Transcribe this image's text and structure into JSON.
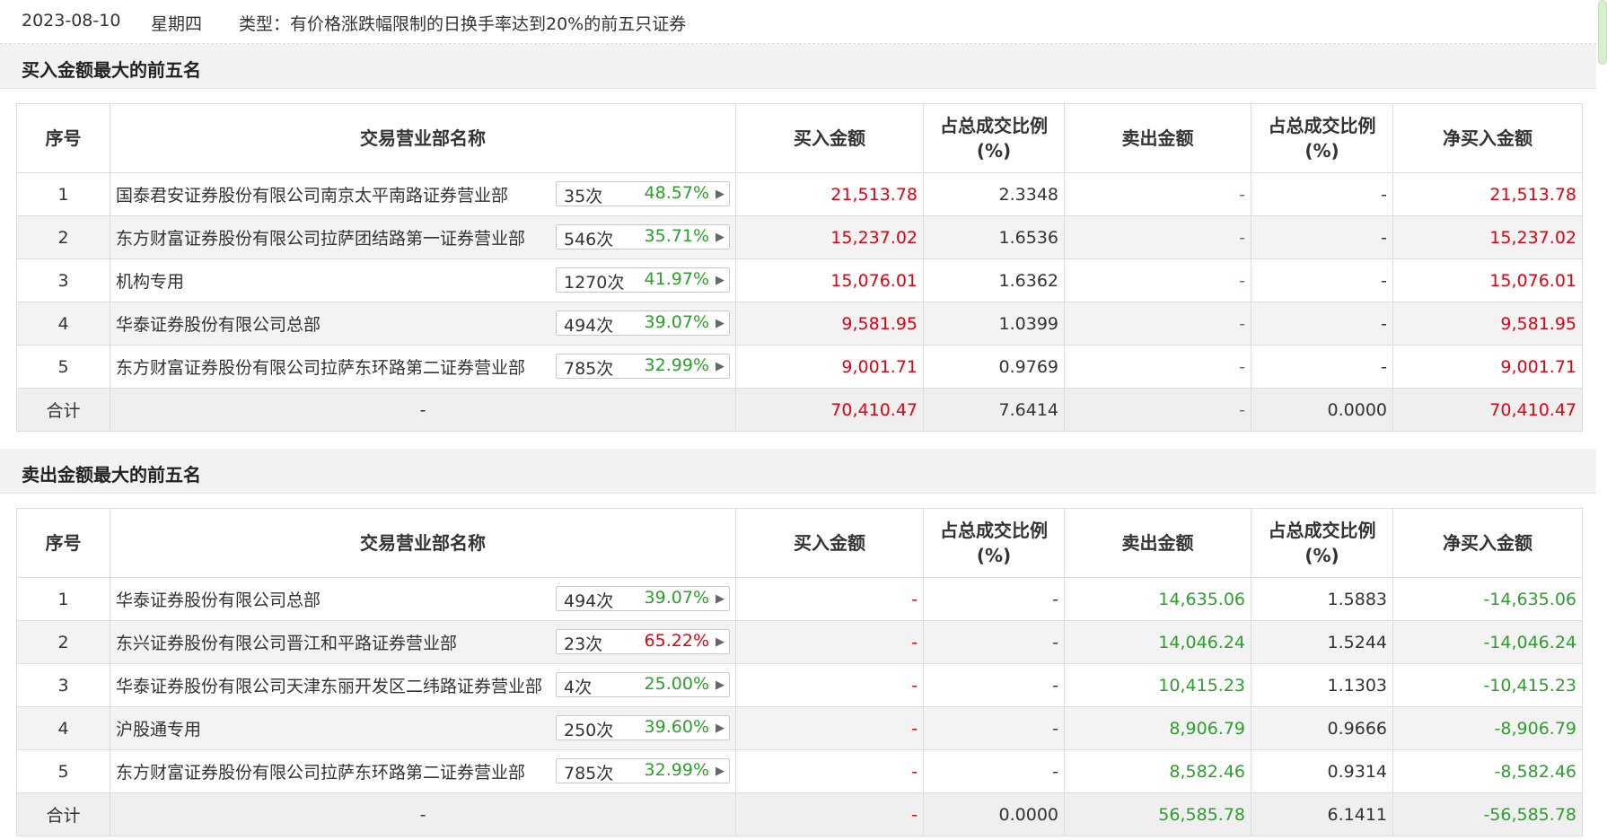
{
  "topbar": {
    "date": "2023-08-10",
    "weekday": "星期四",
    "type_text": "类型：有价格涨跌幅限制的日换手率达到20%的前五只证券"
  },
  "colors": {
    "up": "#e60012",
    "down": "#2ca02c",
    "text": "#333333"
  },
  "icons": {
    "pill_arrow": "chevron-right-icon"
  },
  "buy_section": {
    "title": "买入金额最大的前五名",
    "headers": {
      "seq": "序号",
      "seat": "交易营业部名称",
      "buy": "买入金额",
      "buy_ratio": "占总成交比例(%)",
      "sell": "卖出金额",
      "sell_ratio": "占总成交比例(%)",
      "net": "净买入金额"
    },
    "rows": [
      {
        "seq": "1",
        "seat": "国泰君安证券股份有限公司南京太平南路证券营业部",
        "times": "35次",
        "rate": "48.57%",
        "rate_color": "green",
        "buy": "21,513.78",
        "buy_ratio": "2.3348",
        "sell": "-",
        "sell_ratio": "-",
        "net": "21,513.78"
      },
      {
        "seq": "2",
        "seat": "东方财富证券股份有限公司拉萨团结路第一证券营业部",
        "times": "546次",
        "rate": "35.71%",
        "rate_color": "green",
        "buy": "15,237.02",
        "buy_ratio": "1.6536",
        "sell": "-",
        "sell_ratio": "-",
        "net": "15,237.02"
      },
      {
        "seq": "3",
        "seat": "机构专用",
        "times": "1270次",
        "rate": "41.97%",
        "rate_color": "green",
        "buy": "15,076.01",
        "buy_ratio": "1.6362",
        "sell": "-",
        "sell_ratio": "-",
        "net": "15,076.01"
      },
      {
        "seq": "4",
        "seat": "华泰证券股份有限公司总部",
        "times": "494次",
        "rate": "39.07%",
        "rate_color": "green",
        "buy": "9,581.95",
        "buy_ratio": "1.0399",
        "sell": "-",
        "sell_ratio": "-",
        "net": "9,581.95"
      },
      {
        "seq": "5",
        "seat": "东方财富证券股份有限公司拉萨东环路第二证券营业部",
        "times": "785次",
        "rate": "32.99%",
        "rate_color": "green",
        "buy": "9,001.71",
        "buy_ratio": "0.9769",
        "sell": "-",
        "sell_ratio": "-",
        "net": "9,001.71"
      }
    ],
    "total": {
      "label": "合计",
      "seat": "-",
      "buy": "70,410.47",
      "buy_ratio": "7.6414",
      "sell": "-",
      "sell_ratio": "0.0000",
      "net": "70,410.47"
    }
  },
  "sell_section": {
    "title": "卖出金额最大的前五名",
    "headers": {
      "seq": "序号",
      "seat": "交易营业部名称",
      "buy": "买入金额",
      "buy_ratio": "占总成交比例(%)",
      "sell": "卖出金额",
      "sell_ratio": "占总成交比例(%)",
      "net": "净买入金额"
    },
    "rows": [
      {
        "seq": "1",
        "seat": "华泰证券股份有限公司总部",
        "times": "494次",
        "rate": "39.07%",
        "rate_color": "green",
        "buy": "-",
        "buy_ratio": "-",
        "sell": "14,635.06",
        "sell_ratio": "1.5883",
        "net": "-14,635.06"
      },
      {
        "seq": "2",
        "seat": "东兴证券股份有限公司晋江和平路证券营业部",
        "times": "23次",
        "rate": "65.22%",
        "rate_color": "red",
        "buy": "-",
        "buy_ratio": "-",
        "sell": "14,046.24",
        "sell_ratio": "1.5244",
        "net": "-14,046.24"
      },
      {
        "seq": "3",
        "seat": "华泰证券股份有限公司天津东丽开发区二纬路证券营业部",
        "times": "4次",
        "rate": "25.00%",
        "rate_color": "green",
        "buy": "-",
        "buy_ratio": "-",
        "sell": "10,415.23",
        "sell_ratio": "1.1303",
        "net": "-10,415.23"
      },
      {
        "seq": "4",
        "seat": "沪股通专用",
        "times": "250次",
        "rate": "39.60%",
        "rate_color": "green",
        "buy": "-",
        "buy_ratio": "-",
        "sell": "8,906.79",
        "sell_ratio": "0.9666",
        "net": "-8,906.79"
      },
      {
        "seq": "5",
        "seat": "东方财富证券股份有限公司拉萨东环路第二证券营业部",
        "times": "785次",
        "rate": "32.99%",
        "rate_color": "green",
        "buy": "-",
        "buy_ratio": "-",
        "sell": "8,582.46",
        "sell_ratio": "0.9314",
        "net": "-8,582.46"
      }
    ],
    "total": {
      "label": "合计",
      "seat": "-",
      "buy": "-",
      "buy_ratio": "0.0000",
      "sell": "56,585.78",
      "sell_ratio": "6.1411",
      "net": "-56,585.78"
    }
  }
}
